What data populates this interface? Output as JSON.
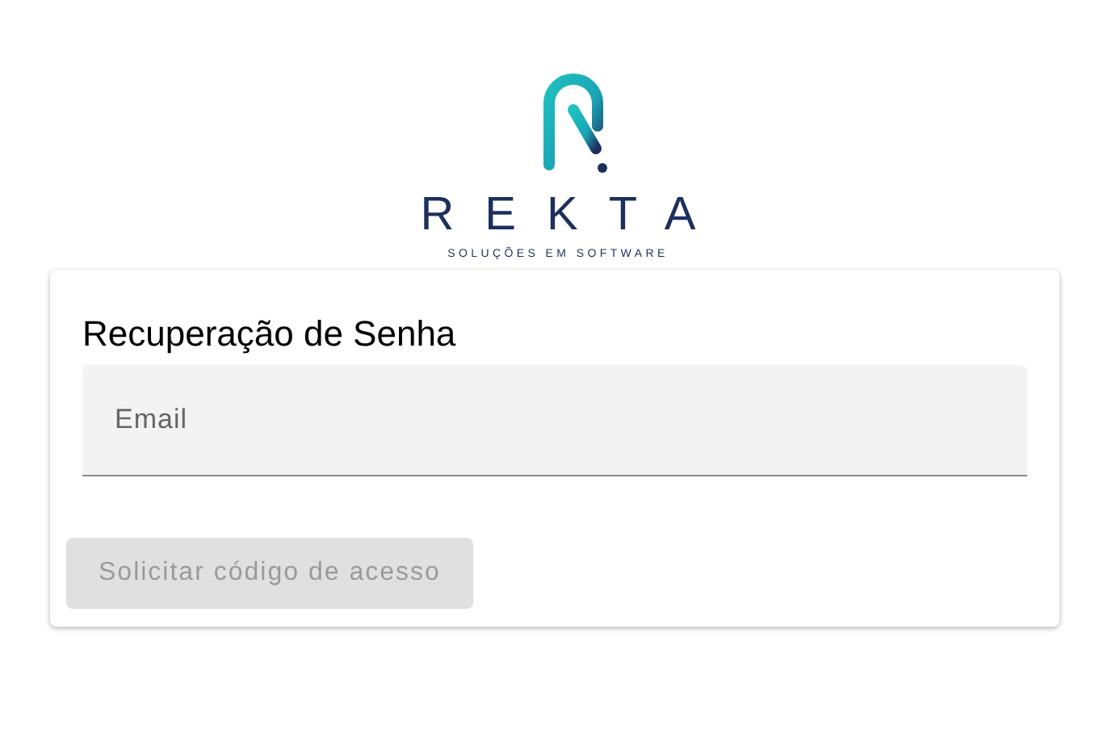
{
  "logo": {
    "name": "REKTA",
    "tagline": "SOLUÇÕES EM SOFTWARE"
  },
  "card": {
    "title": "Recuperação de Senha",
    "email_field": {
      "placeholder": "Email"
    },
    "submit_button": {
      "label": "Solicitar código de acesso",
      "disabled": true
    }
  }
}
